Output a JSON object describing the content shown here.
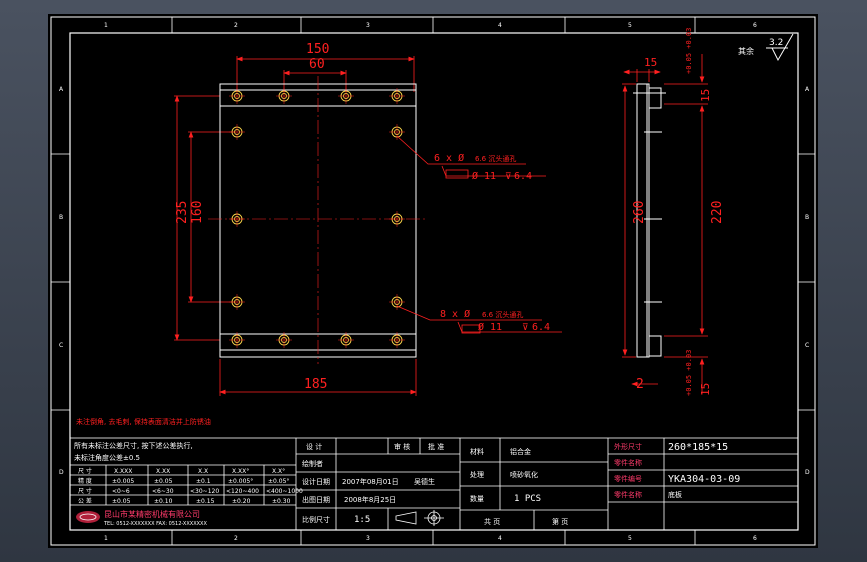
{
  "colors": {
    "frame": "#ffffff",
    "dimension": "#ff2020",
    "center_line": "#ff2020",
    "part": "#ffffff",
    "hole": "#ffd84a",
    "title_text": "#ffffff",
    "title_highlight": "#ff3b6b",
    "background": "#000000"
  },
  "grid": {
    "top": [
      "1",
      "2",
      "3",
      "4",
      "5",
      "6"
    ],
    "bottom": [
      "1",
      "2",
      "3",
      "4",
      "5",
      "6"
    ],
    "left": [
      "A",
      "B",
      "C",
      "D"
    ],
    "right": [
      "A",
      "B",
      "C",
      "D"
    ]
  },
  "roughness": {
    "label": "其余",
    "value": "3.2"
  },
  "front_view": {
    "dim_150": "150",
    "dim_60": "60",
    "dim_235": "235",
    "dim_160": "160",
    "dim_185": "185",
    "callout_top": {
      "prefix": "6 x Ø",
      "spec": "6.6 沉头通孔",
      "sub_a": "Ø 11",
      "sub_b": "6.4"
    },
    "callout_bottom": {
      "prefix": "8 x Ø",
      "spec": "6.6 沉头通孔",
      "sub_a": "Ø 11",
      "sub_b": "6.4"
    }
  },
  "side_view": {
    "dim_15_top": "15",
    "dim_top_tol": "+0.05 +0.03",
    "dim_15_side": "15",
    "dim_260": "260",
    "dim_220": "220",
    "dim_2": "2",
    "dim_15_bottom": "15",
    "dim_bottom_tol": "+0.05 +0.03"
  },
  "notes": {
    "red": "未注倒角, 去毛刺, 保持表面清洁并上防锈油"
  },
  "tolerance_table": {
    "header_lines": [
      "所有未标注公差尺寸, 按下述公差执行,",
      "未标注角度公差±0.5"
    ],
    "cols": [
      "尺 寸",
      "X.XXX",
      "X.XX",
      "X.X",
      "X.XX°",
      "X.X°"
    ],
    "rows": [
      [
        "精 度",
        "±0.005",
        "±0.05",
        "±0.1",
        "±0.005°",
        "±0.05°"
      ],
      [
        "尺 寸",
        "<0~6",
        "<6~30",
        "<30~120",
        "<120~400",
        "<400~1000"
      ],
      [
        "公 差",
        "±0.05",
        "±0.10",
        "±0.15",
        "±0.20",
        "±0.30"
      ]
    ],
    "company": "昆山市某精密机械有限公司",
    "company_sub": "TEL: 0512-XXXXXXX  FAX: 0512-XXXXXXX"
  },
  "title_block": {
    "design": "设 计",
    "review": "审 核",
    "approve": "批 准",
    "drafter": "绘制者",
    "date_label": "设计日期",
    "date_value": "2007年08月01日",
    "author": "吴德生",
    "print_date_label": "出图日期",
    "print_date_value": "2008年8月25日",
    "scale_label": "比例尺寸",
    "scale_value": "1:5",
    "material_label": "材料",
    "material_value": "铝合金",
    "treatment_label": "处理",
    "treatment_value": "喷砂氧化",
    "qty_label": "数量",
    "qty_value": "1 PCS",
    "footer": [
      "共 页",
      "第 页"
    ],
    "size_label": "外形尺寸",
    "size_value": "260*185*15",
    "name_label": "零件名称",
    "drawing_no_label": "零件编号",
    "drawing_no_value": "YKA304-03-09",
    "part_name_label": "零件名称",
    "part_name_value": "底板"
  }
}
